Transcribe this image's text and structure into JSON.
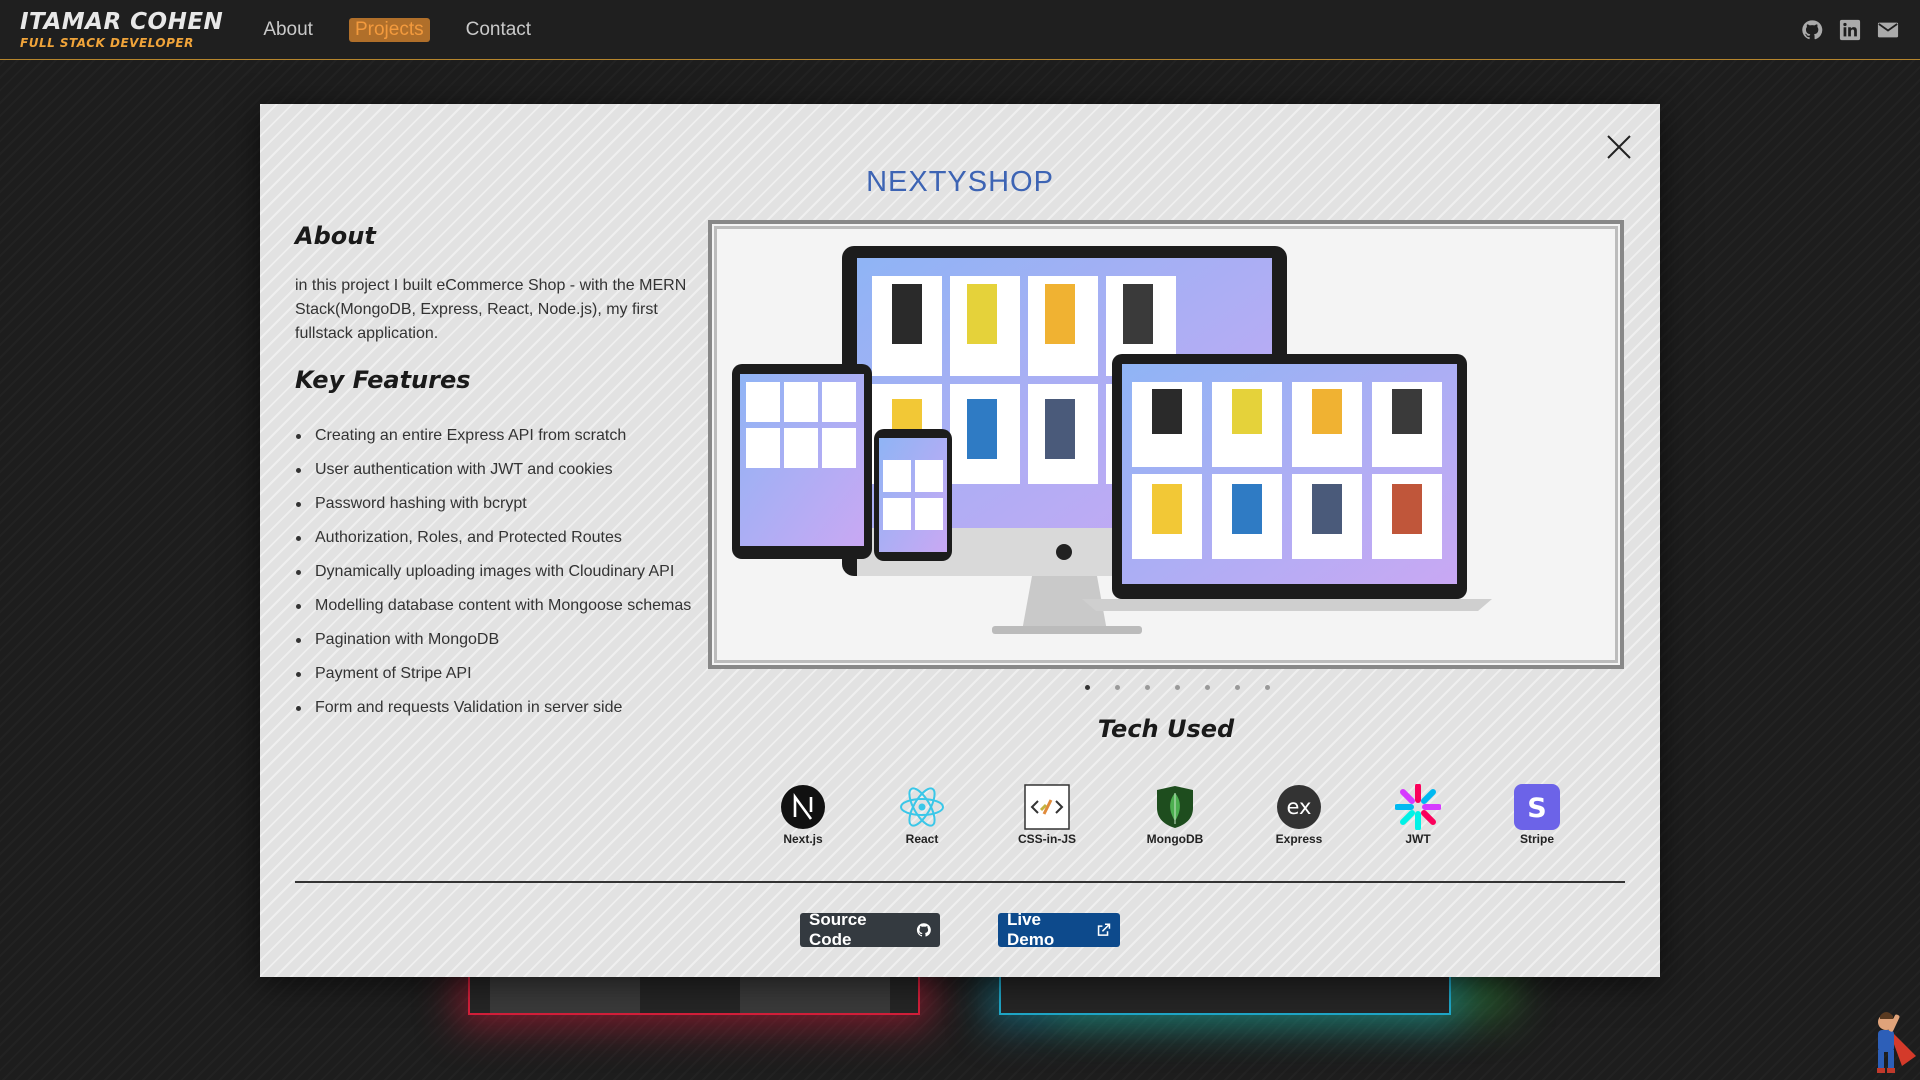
{
  "navbar": {
    "brand_name": "ITAMAR COHEN",
    "brand_sub": "FULL STACK DEVELOPER",
    "links": [
      "About",
      "Projects",
      "Contact"
    ],
    "active_link": "Projects",
    "icons": [
      "github-icon",
      "linkedin-icon",
      "mail-icon"
    ]
  },
  "modal": {
    "title": "NEXTYSHOP",
    "about_heading": "About",
    "about_text": "in this project I built eCommerce Shop - with the MERN Stack(MongoDB, Express, React, Node.js), my first fullstack application.",
    "features_heading": "Key Features",
    "features": [
      "Creating an entire Express API from scratch",
      "User authentication with JWT and cookies",
      "Password hashing with bcrypt",
      "Authorization, Roles, and Protected Routes",
      "Dynamically uploading images with Cloudinary API",
      "Modelling database content with Mongoose schemas",
      "Pagination with MongoDB",
      "Payment of Stripe API",
      "Form and requests Validation in server side"
    ],
    "carousel": {
      "slide_count": 7,
      "active_index": 0
    },
    "tech_heading": "Tech Used",
    "tech": [
      "Next.js",
      "React",
      "CSS-in-JS",
      "MongoDB",
      "Express",
      "JWT",
      "Stripe"
    ],
    "buttons": {
      "source": "Source Code",
      "live": "Live Demo"
    },
    "colors": {
      "title": "#3d64b4",
      "source_btn": "#343a40",
      "live_btn": "#0d4a8c"
    }
  }
}
